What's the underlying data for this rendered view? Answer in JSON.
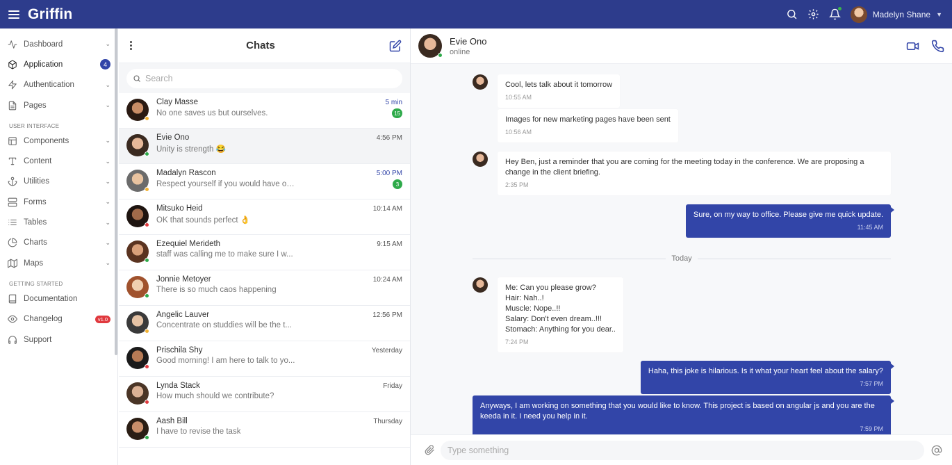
{
  "app": {
    "brand": "Griffin"
  },
  "header": {
    "user_name": "Madelyn Shane",
    "icons": [
      "menu-icon",
      "search-icon",
      "gear-icon",
      "bell-icon",
      "chevron-down-icon"
    ]
  },
  "sidebar": {
    "items": [
      {
        "label": "Dashboard",
        "icon": "activity-icon",
        "chevron": true
      },
      {
        "label": "Application",
        "icon": "box-icon",
        "badge": "4",
        "active": true
      },
      {
        "label": "Authentication",
        "icon": "bolt-icon",
        "chevron": true
      },
      {
        "label": "Pages",
        "icon": "file-icon",
        "chevron": true
      }
    ],
    "section_ui": "USER INTERFACE",
    "ui_items": [
      {
        "label": "Components",
        "icon": "layout-icon"
      },
      {
        "label": "Content",
        "icon": "type-icon"
      },
      {
        "label": "Utilities",
        "icon": "anchor-icon"
      },
      {
        "label": "Forms",
        "icon": "server-icon"
      },
      {
        "label": "Tables",
        "icon": "list-icon"
      },
      {
        "label": "Charts",
        "icon": "pie-chart-icon"
      },
      {
        "label": "Maps",
        "icon": "map-icon"
      }
    ],
    "section_start": "GETTING STARTED",
    "start_items": [
      {
        "label": "Documentation",
        "icon": "book-icon"
      },
      {
        "label": "Changelog",
        "icon": "eye-icon",
        "badge": "v1.0"
      },
      {
        "label": "Support",
        "icon": "headphones-icon"
      }
    ]
  },
  "chats": {
    "title": "Chats",
    "search_placeholder": "Search",
    "list": [
      {
        "name": "Clay Masse",
        "time": "5 min",
        "message": "No one saves us but ourselves.",
        "badge": "15",
        "status": "#f2b233",
        "unread": true,
        "skin": "#c98d66",
        "hair": "#2a1a12"
      },
      {
        "name": "Evie Ono",
        "time": "4:56 PM",
        "message": "Unity is strength 😂",
        "badge": "",
        "status": "#2eaa4a",
        "unread": false,
        "selected": true,
        "skin": "#e6b899",
        "hair": "#3a2a20"
      },
      {
        "name": "Madalyn Rascon",
        "time": "5:00 PM",
        "message": "Respect yourself if you would have ot...",
        "badge": "3",
        "status": "#f2b233",
        "unread": true,
        "skin": "#e8c3a0",
        "hair": "#6b6b6b"
      },
      {
        "name": "Mitsuko Heid",
        "time": "10:14 AM",
        "message": "OK that sounds perfect 👌",
        "badge": "",
        "status": "#e0393e",
        "unread": false,
        "skin": "#a06a4a",
        "hair": "#1e1410"
      },
      {
        "name": "Ezequiel Merideth",
        "time": "9:15 AM",
        "message": "staff was calling me to make sure I w...",
        "badge": "",
        "status": "#2eaa4a",
        "unread": false,
        "skin": "#d9a07a",
        "hair": "#5a3320"
      },
      {
        "name": "Jonnie Metoyer",
        "time": "10:24 AM",
        "message": "There is so much caos happening",
        "badge": "",
        "status": "#2eaa4a",
        "unread": false,
        "skin": "#f0cfb0",
        "hair": "#a0522d"
      },
      {
        "name": "Angelic Lauver",
        "time": "12:56 PM",
        "message": "Concentrate on studdies will be the t...",
        "badge": "",
        "status": "#f2b233",
        "unread": false,
        "skin": "#e5c2a4",
        "hair": "#3a3a3a"
      },
      {
        "name": "Prischila Shy",
        "time": "Yesterday",
        "message": "Good morning! I am here to talk to yo...",
        "badge": "",
        "status": "#e0393e",
        "unread": false,
        "skin": "#b57a55",
        "hair": "#1a1a1a"
      },
      {
        "name": "Lynda Stack",
        "time": "Friday",
        "message": "How much should we contribute?",
        "badge": "",
        "status": "#e0393e",
        "unread": false,
        "skin": "#dcb295",
        "hair": "#4a3526"
      },
      {
        "name": "Aash Bill",
        "time": "Thursday",
        "message": "I have to revise the task",
        "badge": "",
        "status": "#2eaa4a",
        "unread": false,
        "skin": "#c88e6a",
        "hair": "#2a1d14"
      }
    ]
  },
  "conversation": {
    "name": "Evie Ono",
    "status": "online",
    "composer_placeholder": "Type something",
    "divider": "Today",
    "messages": [
      {
        "dir": "in",
        "avatar": true,
        "lines": [
          "Cool, lets talk about it tomorrow"
        ],
        "time": "10:55 AM"
      },
      {
        "dir": "in",
        "avatar": false,
        "lines": [
          "Images for new marketing pages have been sent"
        ],
        "time": "10:56 AM"
      },
      {
        "dir": "in",
        "avatar": true,
        "lines": [
          "Hey Ben, just a reminder that you are coming for the meeting today in the conference. We are proposing a",
          "change in the client briefing."
        ],
        "time": "2:35 PM"
      },
      {
        "dir": "out",
        "lines": [
          "Sure, on my way to office. Please give me quick update."
        ],
        "time": "11:45 AM"
      },
      {
        "dir": "in",
        "avatar": true,
        "lines": [
          "Me: Can you please grow?",
          "Hair: Nah..!",
          "Muscle: Nope..!!",
          "Salary: Don't even dream..!!!",
          "Stomach: Anything for you dear.."
        ],
        "time": "7:24 PM"
      },
      {
        "dir": "out",
        "lines": [
          "Haha, this joke is hilarious. Is it what your heart feel about the salary?"
        ],
        "time": "7:57 PM"
      },
      {
        "dir": "out",
        "lines": [
          "Anyways, I am working on something that you would like to know. This project is based on angular js and you are the",
          "keeda in it. I need you help in it."
        ],
        "time": "7:59 PM"
      }
    ]
  },
  "colors": {
    "primary": "#2d3c8c",
    "accent": "#3245a8",
    "online": "#2eaa4a",
    "away": "#f2b233",
    "busy": "#e0393e"
  }
}
